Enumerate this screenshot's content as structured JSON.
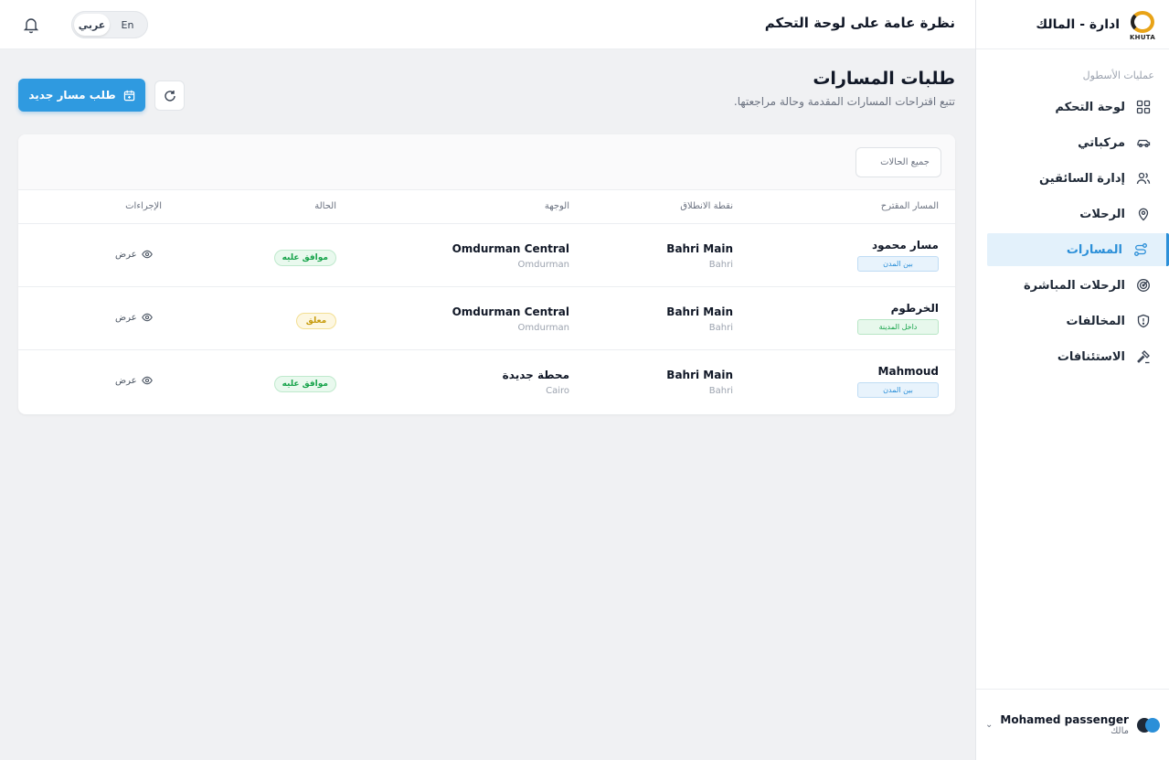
{
  "brand": {
    "logo_text": "KHUTA",
    "title": "ادارة - المالك"
  },
  "sidebar": {
    "section_label": "عمليات الأسطول",
    "items": [
      {
        "label": "لوحة التحكم",
        "icon": "dashboard-icon"
      },
      {
        "label": "مركباتي",
        "icon": "car-icon"
      },
      {
        "label": "إدارة السائقين",
        "icon": "users-icon"
      },
      {
        "label": "الرحلات",
        "icon": "map-pin-icon"
      },
      {
        "label": "المسارات",
        "icon": "route-icon",
        "active": true
      },
      {
        "label": "الرحلات المباشرة",
        "icon": "radar-icon"
      },
      {
        "label": "المخالفات",
        "icon": "shield-alert-icon"
      },
      {
        "label": "الاستئنافات",
        "icon": "gavel-icon"
      }
    ]
  },
  "user": {
    "name": "Mohamed passenger",
    "role": "مالك"
  },
  "topbar": {
    "title": "نظرة عامة على لوحة التحكم",
    "lang_en": "En",
    "lang_ar": "عربي",
    "active_lang": "ar"
  },
  "header": {
    "title": "طلبات المسارات",
    "subtitle": "تتبع اقتراحات المسارات المقدمة وحالة مراجعتها.",
    "new_button": "طلب مسار جديد"
  },
  "filter": {
    "value": "جميع الحالات"
  },
  "table": {
    "columns": {
      "route": "المسار المقترح",
      "start": "نقطة الانطلاق",
      "destination": "الوجهة",
      "status": "الحالة",
      "actions": "الإجراءات"
    },
    "rows": [
      {
        "route": "مسار محمود",
        "tag": "بين المدن",
        "tag_type": "inter",
        "start": "Bahri Main",
        "start_city": "Bahri",
        "dest": "Omdurman Central",
        "dest_city": "Omdurman",
        "status": "موافق عليه",
        "status_type": "approved",
        "action": "عرض"
      },
      {
        "route": "الخرطوم",
        "tag": "داخل المدينة",
        "tag_type": "intra",
        "start": "Bahri Main",
        "start_city": "Bahri",
        "dest": "Omdurman Central",
        "dest_city": "Omdurman",
        "status": "معلق",
        "status_type": "pending",
        "action": "عرض"
      },
      {
        "route": "Mahmoud",
        "tag": "بين المدن",
        "tag_type": "inter",
        "start": "Bahri Main",
        "start_city": "Bahri",
        "dest": "محطة جديدة",
        "dest_city": "Cairo",
        "status": "موافق عليه",
        "status_type": "approved",
        "action": "عرض"
      }
    ]
  },
  "colors": {
    "accent": "#2b8fd8",
    "primary_button": "#2f9ae0",
    "approved": "#16a34a",
    "pending": "#c79a0a"
  }
}
